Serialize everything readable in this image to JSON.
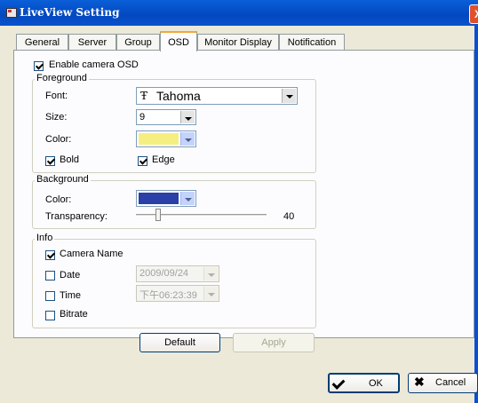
{
  "window": {
    "title": "LiveView Setting",
    "close_glyph": "X"
  },
  "tabs": [
    "General",
    "Server",
    "Group",
    "OSD",
    "Monitor Display",
    "Notification"
  ],
  "active_tab": "OSD",
  "osd": {
    "enable_label": "Enable camera OSD",
    "enable_checked": true,
    "foreground": {
      "title": "Foreground",
      "font_label": "Font:",
      "font_icon": "Ŧ",
      "font_value": "Tahoma",
      "size_label": "Size:",
      "size_value": "9",
      "color_label": "Color:",
      "color_value": "#f5ef82",
      "bold_label": "Bold",
      "bold_checked": true,
      "edge_label": "Edge",
      "edge_checked": true
    },
    "background": {
      "title": "Background",
      "color_label": "Color:",
      "color_value": "#2a3fa8",
      "transparency_label": "Transparency:",
      "transparency_value": "40"
    },
    "info": {
      "title": "Info",
      "camera_name_label": "Camera Name",
      "camera_name_checked": true,
      "date_label": "Date",
      "date_checked": false,
      "date_value": "2009/09/24",
      "time_label": "Time",
      "time_checked": false,
      "time_value": "下午06:23:39",
      "bitrate_label": "Bitrate",
      "bitrate_checked": false
    },
    "default_button": "Default",
    "apply_button": "Apply"
  },
  "dialog": {
    "ok_button": "OK",
    "cancel_button": "Cancel"
  },
  "icons": {
    "window": "app-window-icon",
    "ok": "checkmark-icon",
    "cancel": "x-icon",
    "font": "truetype-font-icon"
  }
}
